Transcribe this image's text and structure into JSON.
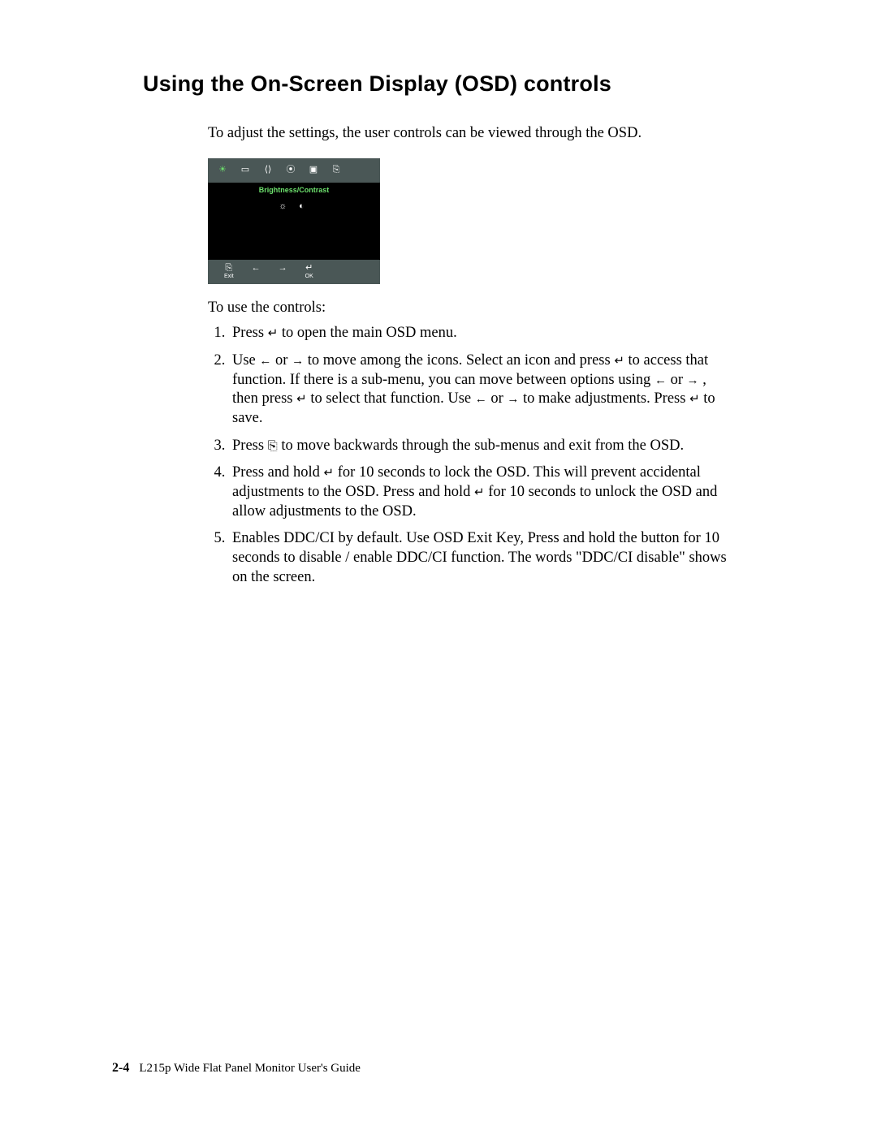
{
  "heading": "Using the On-Screen Display (OSD) controls",
  "intro": "To adjust the settings, the user controls can be viewed through the OSD.",
  "osd": {
    "title": "Brightness/Contrast",
    "sub_icons": "☼  ◐",
    "top_icons": [
      "☀",
      "▭",
      "⟨⟩",
      "⦿",
      "▣",
      "⎘"
    ],
    "bottom": {
      "exit_glyph": "⎘",
      "exit_label": "Exit",
      "left_glyph": "←",
      "right_glyph": "→",
      "ok_glyph": "↵",
      "ok_label": "OK"
    }
  },
  "lead": "To use the controls:",
  "steps": {
    "s1a": "Press ",
    "s1b": " to open the main OSD menu.",
    "s2a": "Use ",
    "s2b": " or ",
    "s2c": " to move among the icons. Select an icon and press ",
    "s2d": " to access that function. If there is a sub-menu, you can move between options using ",
    "s2e": " or ",
    "s2f": " , then press ",
    "s2g": " to select that function. Use ",
    "s2h": " or ",
    "s2i": " to make adjustments. Press ",
    "s2j": " to save.",
    "s3a": "Press ",
    "s3b": " to move backwards through the sub-menus and exit from the OSD.",
    "s4a": "Press and hold ",
    "s4b": " for 10 seconds to lock the OSD. This will prevent accidental adjustments to the OSD. Press and hold ",
    "s4c": " for 10  seconds to unlock the OSD and allow adjustments to the OSD.",
    "s5": "Enables DDC/CI by default. Use OSD Exit Key, Press and hold the   button for 10 seconds to disable / enable DDC/CI function. The words \"DDC/CI disable\" shows on the screen."
  },
  "symbols": {
    "enter": "↵",
    "left": "←",
    "right": "→",
    "exit": "⎘"
  },
  "footer": {
    "page": "2-4",
    "doc": "L215p Wide Flat Panel Monitor User's Guide"
  }
}
